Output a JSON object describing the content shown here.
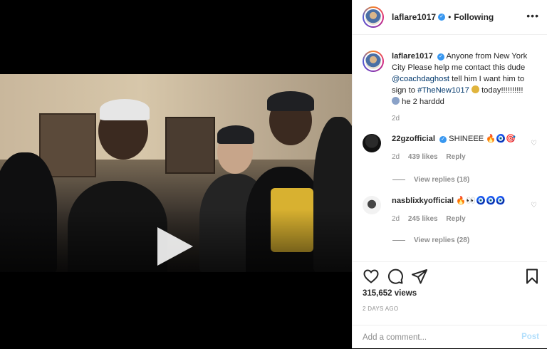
{
  "post": {
    "username": "laflare1017",
    "follow_separator": "•",
    "following_label": "Following",
    "more_label": "•••",
    "caption": {
      "username": "laflare1017",
      "text_1": "Anyone from New York City Please help me contact this dude",
      "mention": "@coachdaghost",
      "text_2": "tell him I want him to sign to",
      "hashtag": "#TheNew1017",
      "text_3": "today!!!!!!!!!!",
      "text_4": "he 2 harddd",
      "time": "2d"
    },
    "comments": [
      {
        "username": "22gzofficial",
        "text": "SHINEEE",
        "emojis": "🔥🧿🎯",
        "time": "2d",
        "likes": "439 likes",
        "reply_label": "Reply",
        "view_replies": "View replies (18)"
      },
      {
        "username": "nasblixkyofficial",
        "emojis": "🔥👀🧿🧿🧿",
        "time": "2d",
        "likes": "245 likes",
        "reply_label": "Reply",
        "view_replies": "View replies (28)"
      }
    ],
    "views": "315,652 views",
    "date": "2 DAYS AGO",
    "add_comment_placeholder": "Add a comment...",
    "post_label": "Post"
  },
  "icons": {
    "like": "heart-icon",
    "comment": "comment-icon",
    "share": "share-icon",
    "save": "bookmark-icon"
  },
  "colors": {
    "link": "#00376b",
    "verified": "#3897f0",
    "muted": "#8e8e8e",
    "post_disabled": "#b2dffc"
  }
}
